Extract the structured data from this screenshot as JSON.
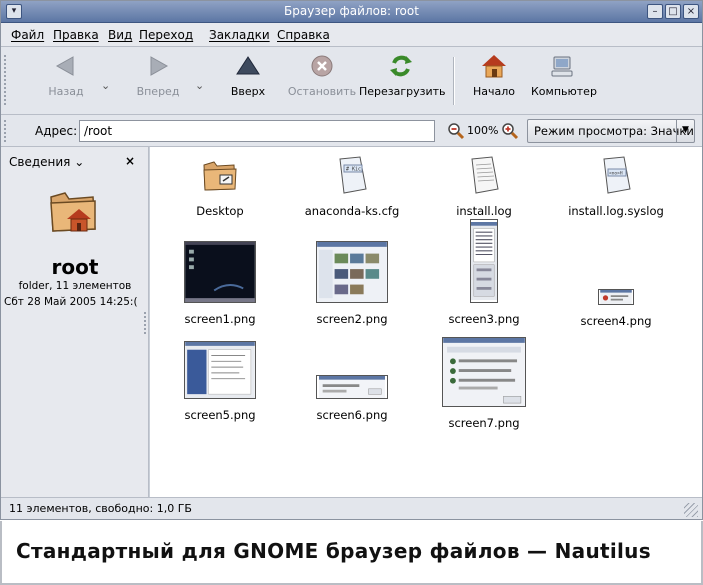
{
  "window": {
    "title": "Браузер файлов: root"
  },
  "menubar": {
    "items": [
      "Файл",
      "Правка",
      "Вид",
      "Переход",
      "Закладки",
      "Справка"
    ]
  },
  "toolbar": {
    "back": "Назад",
    "forward": "Вперед",
    "up": "Вверх",
    "stop": "Остановить",
    "reload": "Перезагрузить",
    "home": "Начало",
    "computer": "Компьютер"
  },
  "location": {
    "label": "Адрес:",
    "value": "/root",
    "zoom": "100%",
    "view_mode": "Режим просмотра: Значки"
  },
  "sidepane": {
    "header": "Сведения",
    "close": "×",
    "folder_name": "root",
    "info": "folder, 11 элементов",
    "date": "Сбт 28 Май 2005 14:25:("
  },
  "files": [
    {
      "name": "Desktop",
      "kind": "folder"
    },
    {
      "name": "anaconda-ks.cfg",
      "kind": "text-code"
    },
    {
      "name": "install.log",
      "kind": "text"
    },
    {
      "name": "install.log.syslog",
      "kind": "text-code"
    },
    {
      "name": "screen1.png",
      "kind": "image"
    },
    {
      "name": "screen2.png",
      "kind": "image"
    },
    {
      "name": "screen3.png",
      "kind": "image"
    },
    {
      "name": "screen4.png",
      "kind": "image"
    },
    {
      "name": "screen5.png",
      "kind": "image"
    },
    {
      "name": "screen6.png",
      "kind": "image"
    },
    {
      "name": "screen7.png",
      "kind": "image"
    }
  ],
  "statusbar": {
    "text": "11 элементов, свободно: 1,0 ГБ"
  },
  "caption": "Стандартный для GNOME браузер файлов — Nautilus"
}
